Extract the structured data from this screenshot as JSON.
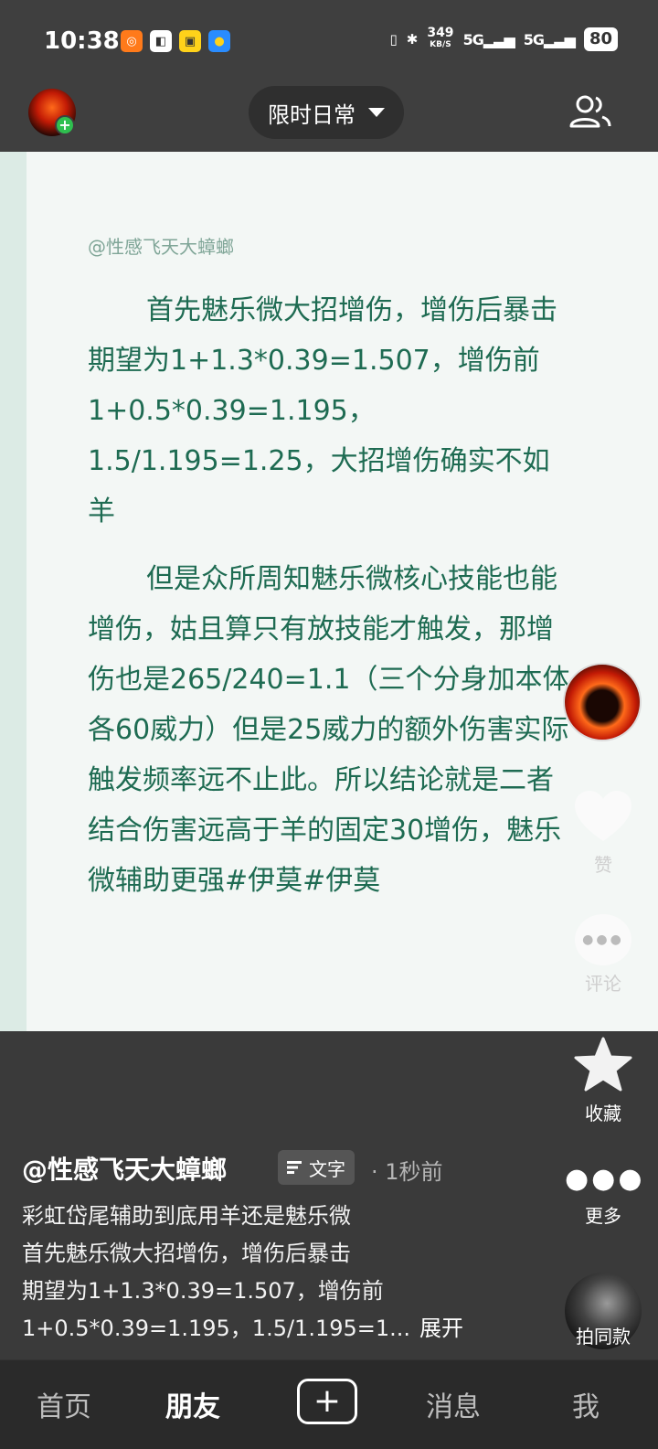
{
  "status_bar": {
    "time": "10:38",
    "app_icons": [
      "didi-icon",
      "app-icon",
      "news-icon",
      "qq-icon"
    ],
    "net_speed": "349",
    "net_unit": "KB/S",
    "signal1": "5G",
    "signal2": "5G",
    "battery": "80"
  },
  "header": {
    "dropdown_label": "限时日常"
  },
  "post": {
    "author_tag": "@性感飞天大蟑螂",
    "paragraph1": "首先魅乐微大招增伤，增伤后暴击期望为1+1.3*0.39=1.507，增伤前1+0.5*0.39=1.195，1.5/1.195=1.25，大招增伤确实不如羊",
    "paragraph2": "但是众所周知魅乐微核心技能也能增伤，姑且算只有放技能才触发，那增伤也是265/240=1.1（三个分身加本体各60威力）但是25威力的额外伤害实际触发频率远不止此。所以结论就是二者结合伤害远高于羊的固定30增伤，魅乐微辅助更强#伊莫#伊莫"
  },
  "rail": {
    "like_label": "赞",
    "comment_label": "评论",
    "collect_label": "收藏",
    "more_label": "更多",
    "same_label": "拍同款"
  },
  "caption": {
    "author": "@性感飞天大蟑螂",
    "type_label": "文字",
    "time_ago": "· 1秒前",
    "line1": "彩虹岱尾辅助到底用羊还是魅乐微",
    "line2": "首先魅乐微大招增伤，增伤后暴击",
    "line3": "期望为1+1.3*0.39=1.507，增伤前",
    "line4": "1+0.5*0.39=1.195，1.5/1.195=1...",
    "expand_label": "展开"
  },
  "nav": {
    "home": "首页",
    "friends": "朋友",
    "messages": "消息",
    "me": "我"
  }
}
